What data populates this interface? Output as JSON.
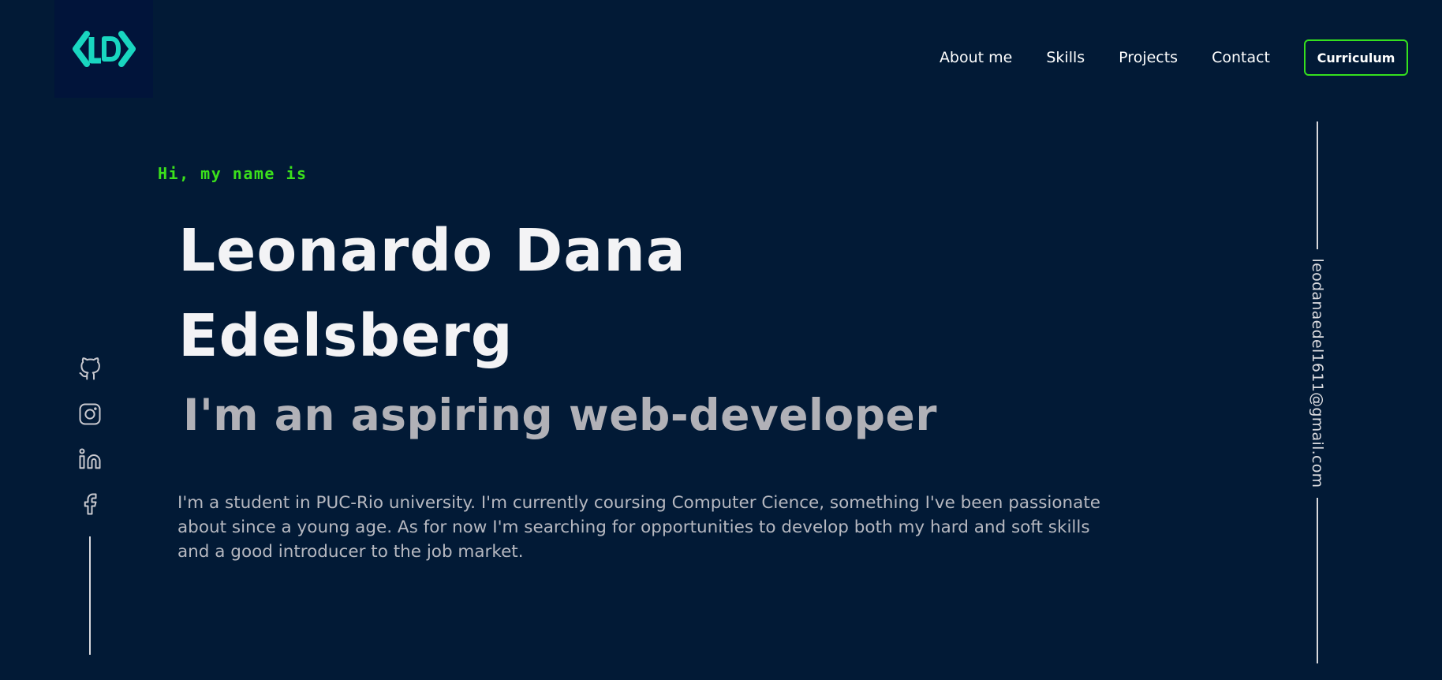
{
  "logo": {
    "icon": "ld-code-logo",
    "color": "#19d6c0"
  },
  "nav": {
    "items": [
      {
        "label": "About me"
      },
      {
        "label": "Skills"
      },
      {
        "label": "Projects"
      },
      {
        "label": "Contact"
      }
    ],
    "cta_label": "Curriculum",
    "cta_border_color": "#35e01e"
  },
  "hero": {
    "greeting": "Hi, my name is",
    "name_line1": "Leonardo Dana",
    "name_line2": "Edelsberg",
    "tagline": "I'm an aspiring web-developer",
    "bio": "I'm a student in PUC-Rio university. I'm currently coursing Computer Cience, something I've been passionate about since a young age. As for now I'm searching for opportunities to develop both my hard and soft skills and a good introducer to the job market."
  },
  "social": {
    "icons": [
      "github-icon",
      "instagram-icon",
      "linkedin-icon",
      "facebook-icon"
    ]
  },
  "email": "leodanaedel1611@gmail.com",
  "colors": {
    "background": "#021a36",
    "accent_green": "#3be11b",
    "logo_teal": "#19d6c0",
    "text_light": "#f3f3f5",
    "text_muted": "#b1b1b7"
  }
}
